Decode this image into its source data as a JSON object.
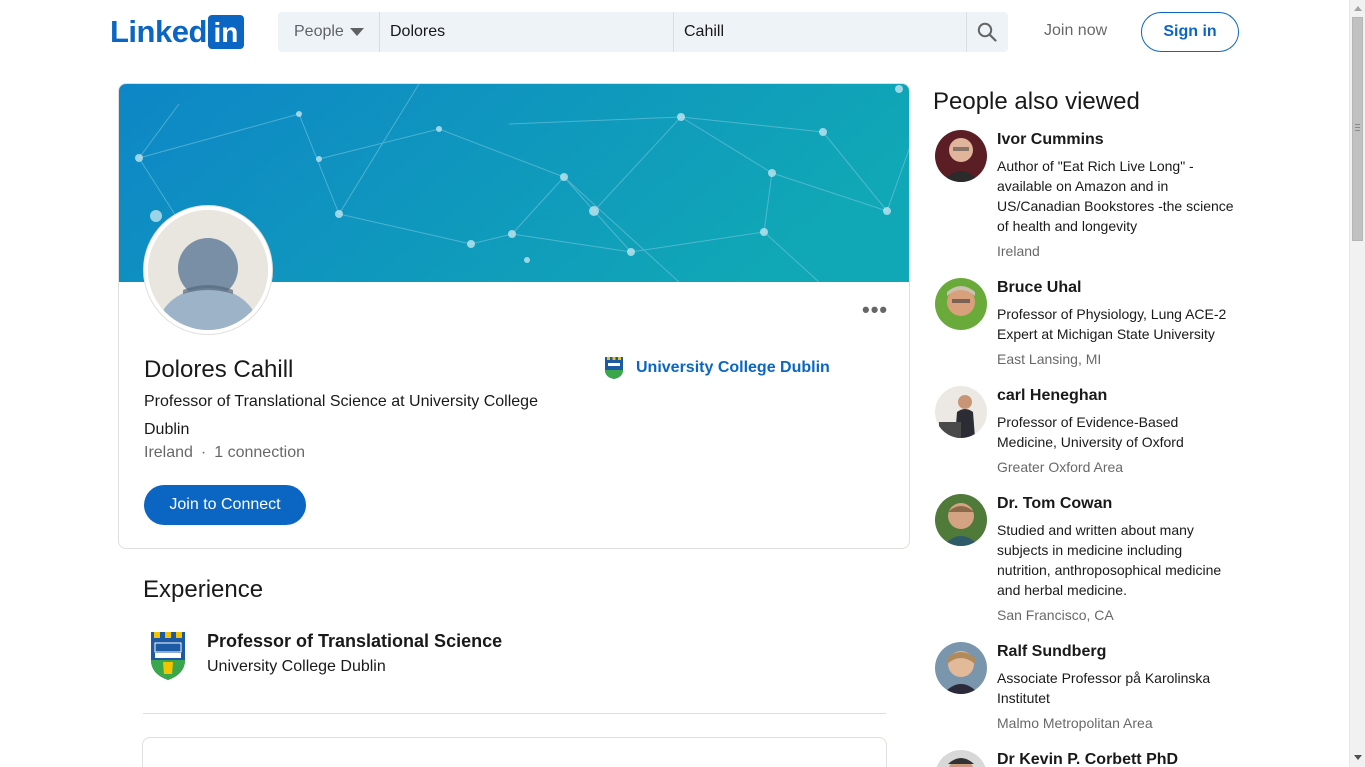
{
  "header": {
    "logo_text": "Linked",
    "logo_in": "in",
    "search": {
      "category": "People",
      "first_name": "Dolores",
      "last_name": "Cahill"
    },
    "join_now": "Join now",
    "sign_in": "Sign in"
  },
  "profile": {
    "name": "Dolores Cahill",
    "headline": "Professor of Translational Science at University College Dublin",
    "location": "Ireland",
    "separator": "·",
    "connections": "1 connection",
    "join_button": "Join to Connect",
    "current_org": "University College Dublin",
    "more_label": "•••"
  },
  "experience": {
    "title": "Experience",
    "items": [
      {
        "role": "Professor of Translational Science",
        "org": "University College Dublin"
      }
    ]
  },
  "people_also_viewed": {
    "title": "People also viewed",
    "people": [
      {
        "name": "Ivor Cummins",
        "description": "Author of \"Eat Rich Live Long\" - available on Amazon and in US/Canadian Bookstores -the science of health and longevity",
        "location": "Ireland"
      },
      {
        "name": "Bruce Uhal",
        "description": "Professor of Physiology, Lung ACE-2 Expert at Michigan State University",
        "location": "East Lansing, MI"
      },
      {
        "name": "carl Heneghan",
        "description": "Professor of Evidence-Based Medicine, University of Oxford",
        "location": "Greater Oxford Area"
      },
      {
        "name": "Dr. Tom Cowan",
        "description": "Studied and written about many subjects in medicine including nutrition, anthroposophical medicine and herbal medicine.",
        "location": "San Francisco, CA"
      },
      {
        "name": "Ralf Sundberg",
        "description": "Associate Professor på Karolinska Institutet",
        "location": "Malmo Metropolitan Area"
      },
      {
        "name": "Dr Kevin P. Corbett PhD",
        "description": "",
        "location": ""
      }
    ]
  },
  "colors": {
    "brand": "#0a66c2",
    "banner_start": "#0e86c6",
    "banner_end": "#10a7b6"
  },
  "icons": {
    "search": "search-icon",
    "caret": "caret-down-icon",
    "more": "more-horizontal-icon",
    "org_logo": "ucd-logo",
    "avatar": "default-avatar-icon"
  }
}
